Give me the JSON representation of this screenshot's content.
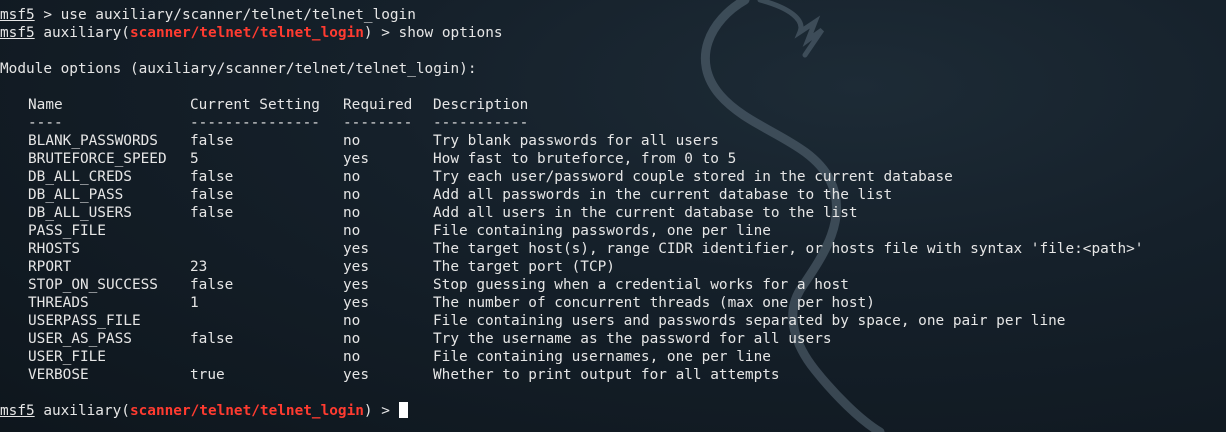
{
  "header_lines": [
    {
      "prompt": "msf5",
      "text": " > use auxiliary/scanner/telnet/telnet_login"
    }
  ],
  "show_line": {
    "prompt": "msf5",
    "pre": " auxiliary(",
    "module": "scanner/telnet/telnet_login",
    "post": ") > show options"
  },
  "module_title": "Module options (auxiliary/scanner/telnet/telnet_login):",
  "columns": {
    "name": "Name",
    "setting": "Current Setting",
    "required": "Required",
    "description": "Description",
    "name_sep": "----",
    "setting_sep": "---------------",
    "required_sep": "--------",
    "description_sep": "-----------"
  },
  "options": [
    {
      "name": "BLANK_PASSWORDS",
      "setting": "false",
      "required": "no",
      "description": "Try blank passwords for all users"
    },
    {
      "name": "BRUTEFORCE_SPEED",
      "setting": "5",
      "required": "yes",
      "description": "How fast to bruteforce, from 0 to 5"
    },
    {
      "name": "DB_ALL_CREDS",
      "setting": "false",
      "required": "no",
      "description": "Try each user/password couple stored in the current database"
    },
    {
      "name": "DB_ALL_PASS",
      "setting": "false",
      "required": "no",
      "description": "Add all passwords in the current database to the list"
    },
    {
      "name": "DB_ALL_USERS",
      "setting": "false",
      "required": "no",
      "description": "Add all users in the current database to the list"
    },
    {
      "name": "PASS_FILE",
      "setting": "",
      "required": "no",
      "description": "File containing passwords, one per line"
    },
    {
      "name": "RHOSTS",
      "setting": "",
      "required": "yes",
      "description": "The target host(s), range CIDR identifier, or hosts file with syntax 'file:<path>'"
    },
    {
      "name": "RPORT",
      "setting": "23",
      "required": "yes",
      "description": "The target port (TCP)"
    },
    {
      "name": "STOP_ON_SUCCESS",
      "setting": "false",
      "required": "yes",
      "description": "Stop guessing when a credential works for a host"
    },
    {
      "name": "THREADS",
      "setting": "1",
      "required": "yes",
      "description": "The number of concurrent threads (max one per host)"
    },
    {
      "name": "USERPASS_FILE",
      "setting": "",
      "required": "no",
      "description": "File containing users and passwords separated by space, one pair per line"
    },
    {
      "name": "USER_AS_PASS",
      "setting": "false",
      "required": "no",
      "description": "Try the username as the password for all users"
    },
    {
      "name": "USER_FILE",
      "setting": "",
      "required": "no",
      "description": "File containing usernames, one per line"
    },
    {
      "name": "VERBOSE",
      "setting": "true",
      "required": "yes",
      "description": "Whether to print output for all attempts"
    }
  ],
  "final_prompt": {
    "prompt": "msf5",
    "pre": " auxiliary(",
    "module": "scanner/telnet/telnet_login",
    "post": ") > "
  },
  "colors": {
    "background": "#15202a",
    "text": "#e6e6e6",
    "module_highlight": "#ff3b30",
    "cursor": "#ffffff"
  },
  "icons": {
    "background": "kali-dragon-watermark-icon"
  }
}
